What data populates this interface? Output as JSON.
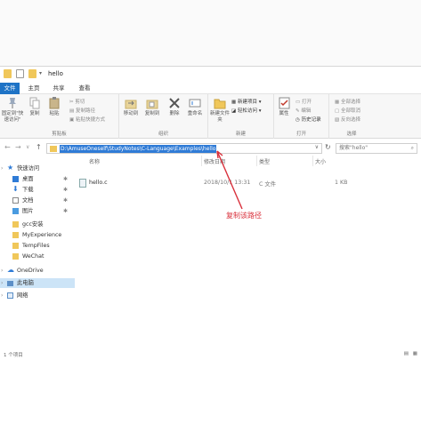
{
  "window": {
    "title": "hello"
  },
  "tabs": [
    "文件",
    "主页",
    "共享",
    "查看"
  ],
  "ribbon": {
    "clipboard": {
      "group_label": "剪贴板",
      "pin_label": "固定到\"快速访问\"",
      "copy_label": "复制",
      "paste_label": "粘贴",
      "cut_label": "剪切",
      "copy_path_label": "复制路径",
      "paste_shortcut_label": "粘贴快捷方式"
    },
    "organize": {
      "group_label": "组织",
      "move_to_label": "移动到",
      "copy_to_label": "复制到",
      "delete_label": "删除",
      "rename_label": "重命名"
    },
    "new": {
      "group_label": "新建",
      "new_folder_label": "新建文件夹",
      "new_item_label": "新建项目",
      "easy_access_label": "轻松访问"
    },
    "open": {
      "group_label": "打开",
      "properties_label": "属性",
      "open_label": "打开",
      "edit_label": "编辑",
      "history_label": "历史记录"
    },
    "select": {
      "group_label": "选择",
      "select_all_label": "全部选择",
      "select_none_label": "全部取消",
      "invert_label": "反向选择"
    }
  },
  "address": {
    "path": "D:\\AmuseOneself\\StudyNotes\\C-Language\\Examples\\hello",
    "search_placeholder": "搜索\"hello\""
  },
  "navigation": {
    "items": [
      {
        "label": "快速访问",
        "icon": "star-icon",
        "pinned": false
      },
      {
        "label": "桌面",
        "icon": "desktop-icon",
        "pinned": true
      },
      {
        "label": "下载",
        "icon": "download-icon",
        "pinned": true
      },
      {
        "label": "文档",
        "icon": "documents-icon",
        "pinned": true
      },
      {
        "label": "图片",
        "icon": "pictures-icon",
        "pinned": true
      },
      {
        "label": "gcc安装",
        "icon": "folder-icon",
        "pinned": false
      },
      {
        "label": "MyExperience",
        "icon": "folder-icon",
        "pinned": false
      },
      {
        "label": "TempFiles",
        "icon": "folder-icon",
        "pinned": false
      },
      {
        "label": "WeChat",
        "icon": "folder-icon",
        "pinned": false
      },
      {
        "label": "OneDrive",
        "icon": "cloud-icon",
        "pinned": false
      },
      {
        "label": "此电脑",
        "icon": "computer-icon",
        "pinned": false
      },
      {
        "label": "网络",
        "icon": "network-icon",
        "pinned": false
      }
    ]
  },
  "columns": {
    "name": "名称",
    "modified": "修改日期",
    "type": "类型",
    "size": "大小"
  },
  "files": [
    {
      "name": "hello.c",
      "modified": "2018/10/1 13:31",
      "type": "C 文件",
      "size": "1 KB"
    }
  ],
  "annotation": {
    "text": "复制该路径"
  },
  "status": {
    "text": "1 个项目"
  },
  "colors": {
    "accent": "#1e73c6",
    "selection": "#2f7bd6",
    "annotation": "#d9303b",
    "folder": "#f0c75a"
  }
}
